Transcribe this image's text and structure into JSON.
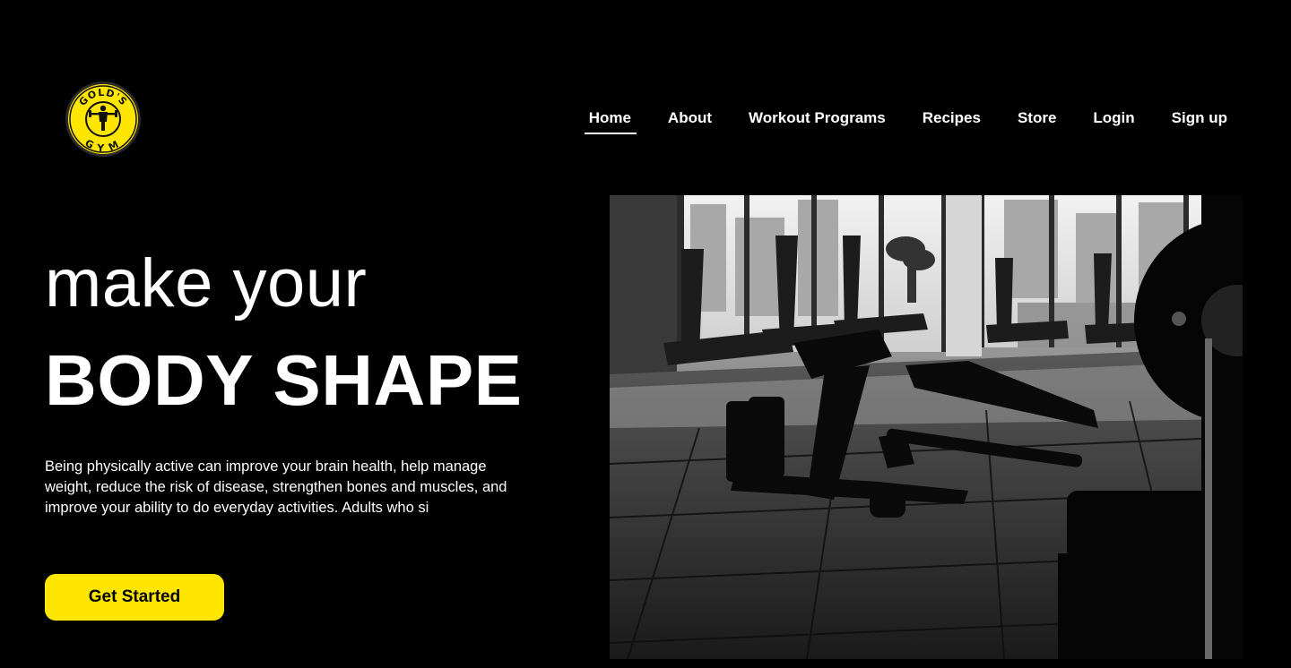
{
  "brand": {
    "logo_text_top": "GOLD'S",
    "logo_text_bottom": "GYM",
    "logo_color": "#ffe600",
    "logo_icon": "golds-gym-logo"
  },
  "nav": {
    "items": [
      {
        "label": "Home",
        "active": true
      },
      {
        "label": "About"
      },
      {
        "label": "Workout Programs"
      },
      {
        "label": "Recipes"
      },
      {
        "label": "Store"
      },
      {
        "label": "Login"
      },
      {
        "label": "Sign up"
      }
    ]
  },
  "hero": {
    "line1": "make your",
    "line2": "BODY SHAPE",
    "description": "Being physically active can improve your brain health, help manage weight, reduce the risk of disease, strengthen bones and muscles, and improve your ability to do everyday activities. Adults who si",
    "cta_label": "Get Started",
    "accent": "#ffe600"
  },
  "image": {
    "subject": "gym-interior-photo"
  }
}
